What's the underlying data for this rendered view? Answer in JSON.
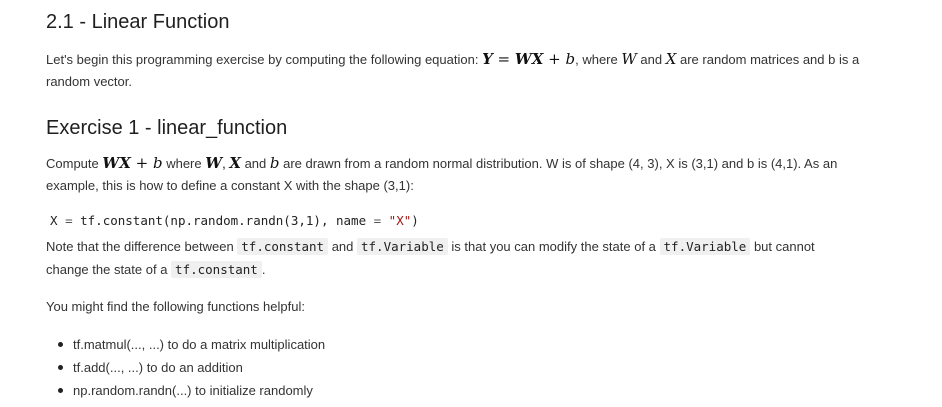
{
  "section": {
    "title": "2.1 - Linear Function"
  },
  "intro": {
    "prefix": "Let's begin this programming exercise by computing the following equation: ",
    "equation": {
      "lhs": "Y",
      "eq": " = ",
      "w": "W",
      "x": "X",
      "plus": " + ",
      "b": "b"
    },
    "mid1": ", where ",
    "w_var": "W",
    "and": " and ",
    "x_var": "X",
    "suffix_line1": " are random matrices and b is a",
    "line2": "random vector."
  },
  "exercise": {
    "title": "Exercise 1 - linear_function",
    "compute": "Compute ",
    "expr": {
      "w": "W",
      "x": "X",
      "plus": " + ",
      "b": "b"
    },
    "where": " where ",
    "vars": {
      "w": "W",
      "x": "X",
      "b": "b",
      "sep": ", ",
      "and": " and "
    },
    "rest_line1": " are drawn from a random normal distribution. W is of shape (4, 3), X is (3,1) and b is (4,1). As an",
    "line2": "example, this is how to define a constant X with the shape (3,1):"
  },
  "code": {
    "lhs": "X ",
    "eq": "=",
    "call": " tf.constant(np.random.randn(3,1), name ",
    "eq2": "=",
    "str": " \"X\"",
    "close": ")"
  },
  "note": {
    "prefix": "Note that the difference between ",
    "code1": "tf.constant",
    "and": " and ",
    "code2": "tf.Variable",
    "mid": " is that you can modify the state of a ",
    "code3": "tf.Variable",
    "end_line1": " but cannot",
    "line2_prefix": "change the state of a ",
    "code4": "tf.constant",
    "line2_end": "."
  },
  "helpful": {
    "text": "You might find the following functions helpful:"
  },
  "functions": [
    "tf.matmul(..., ...) to do a matrix multiplication",
    "tf.add(..., ...) to do an addition",
    "np.random.randn(...) to initialize randomly"
  ]
}
